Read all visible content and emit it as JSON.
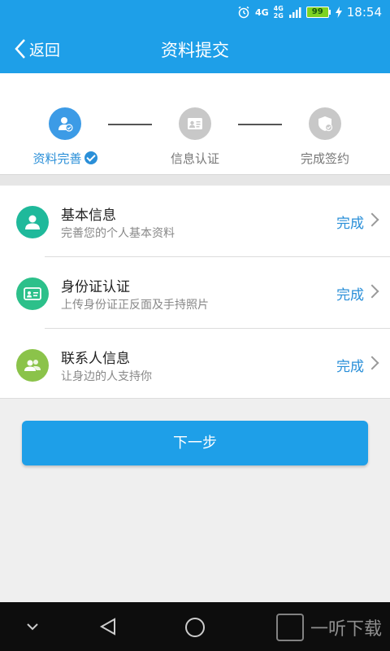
{
  "status_bar": {
    "signal_primary": "4G",
    "signal_secondary_top": "4G",
    "signal_secondary_bottom": "2G",
    "battery": "99",
    "time": "18:54"
  },
  "nav": {
    "back_label": "返回",
    "title": "资料提交"
  },
  "steps": [
    {
      "label": "资料完善",
      "state": "active"
    },
    {
      "label": "信息认证",
      "state": "inactive"
    },
    {
      "label": "完成签约",
      "state": "inactive"
    }
  ],
  "items": [
    {
      "title": "基本信息",
      "subtitle": "完善您的个人基本资料",
      "status": "完成",
      "icon": "user-icon",
      "color": "#1fb99b"
    },
    {
      "title": "身份证认证",
      "subtitle": "上传身份证正反面及手持照片",
      "status": "完成",
      "icon": "id-card-icon",
      "color": "#2cc08a"
    },
    {
      "title": "联系人信息",
      "subtitle": "让身边的人支持你",
      "status": "完成",
      "icon": "contacts-icon",
      "color": "#8bc34a"
    }
  ],
  "next_button": "下一步",
  "watermark": "一听下载",
  "colors": {
    "primary": "#1e9fe8",
    "accent_text": "#2a8fd8",
    "inactive": "#c8c8c8"
  }
}
